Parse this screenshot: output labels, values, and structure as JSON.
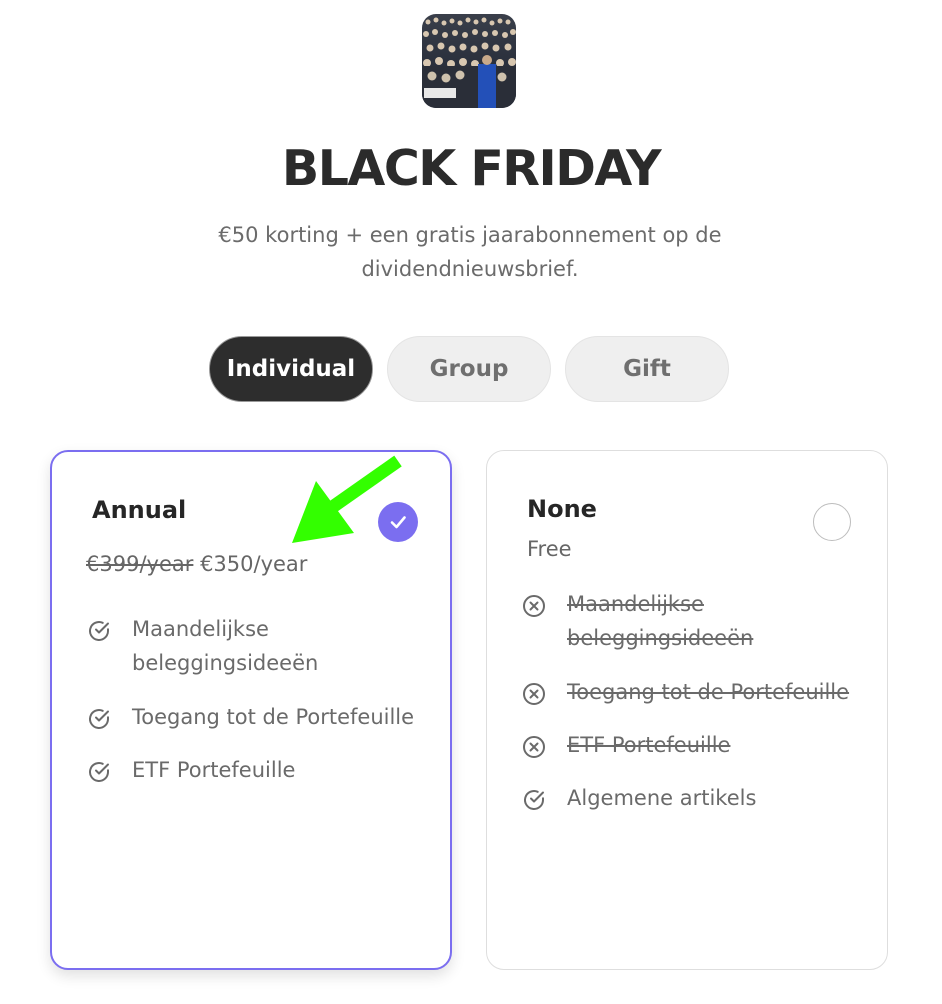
{
  "header": {
    "logo_icon": "conference-crowd-photo",
    "title": "BLACK FRIDAY",
    "subtitle": "€50 korting + een gratis jaarabonnement op de dividendnieuwsbrief."
  },
  "tabs": [
    {
      "label": "Individual",
      "active": true
    },
    {
      "label": "Group",
      "active": false
    },
    {
      "label": "Gift",
      "active": false
    }
  ],
  "plans": {
    "annual": {
      "name": "Annual",
      "old_price": "€399/year",
      "price": "€350/year",
      "selected": true,
      "features": [
        {
          "text": "Maandelijkse beleggingsideeën",
          "included": true
        },
        {
          "text": "Toegang tot de Portefeuille",
          "included": true
        },
        {
          "text": "ETF Portefeuille",
          "included": true
        }
      ]
    },
    "none": {
      "name": "None",
      "price": "Free",
      "selected": false,
      "features": [
        {
          "text": "Maandelijkse beleggingsideeën",
          "included": false
        },
        {
          "text": "Toegang tot de Portefeuille",
          "included": false
        },
        {
          "text": "ETF Portefeuille",
          "included": false
        },
        {
          "text": "Algemene artikels",
          "included": true
        }
      ]
    }
  },
  "colors": {
    "accent": "#7b6ef0",
    "dark": "#2d2d2d",
    "annotation_arrow": "#33ff00"
  }
}
